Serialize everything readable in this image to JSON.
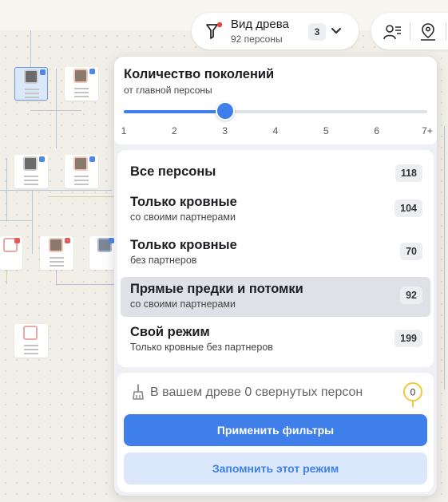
{
  "tree_view": {
    "title": "Вид древа",
    "subtitle": "92 персоны",
    "badge": "3",
    "filter_dot_color": "#e0463e"
  },
  "generations": {
    "title": "Количество поколений",
    "subtitle": "от главной персоны",
    "ticks": [
      "1",
      "2",
      "3",
      "4",
      "5",
      "6",
      "7+"
    ],
    "selected": "3",
    "accent": "#3f7fe9"
  },
  "modes": [
    {
      "title": "Все персоны",
      "subtitle": "",
      "count": "118",
      "active": false
    },
    {
      "title": "Только кровные",
      "subtitle": "со своими партнерами",
      "count": "104",
      "active": false
    },
    {
      "title": "Только кровные",
      "subtitle": "без партнеров",
      "count": "70",
      "active": false
    },
    {
      "title": "Прямые предки и потомки",
      "subtitle": "со своими партнерами",
      "count": "92",
      "active": true
    },
    {
      "title": "Свой режим",
      "subtitle": "Только кровные без партнеров",
      "count": "199",
      "active": false
    }
  ],
  "collapsed": {
    "text": "В вашем древе 0 свернутых персон",
    "count": "0",
    "pin_color": "#f0c93e"
  },
  "actions": {
    "apply": "Применить фильтры",
    "save": "Запомнить этот режим"
  },
  "toolbar_icons": [
    "person-list-icon",
    "map-pin-icon"
  ]
}
